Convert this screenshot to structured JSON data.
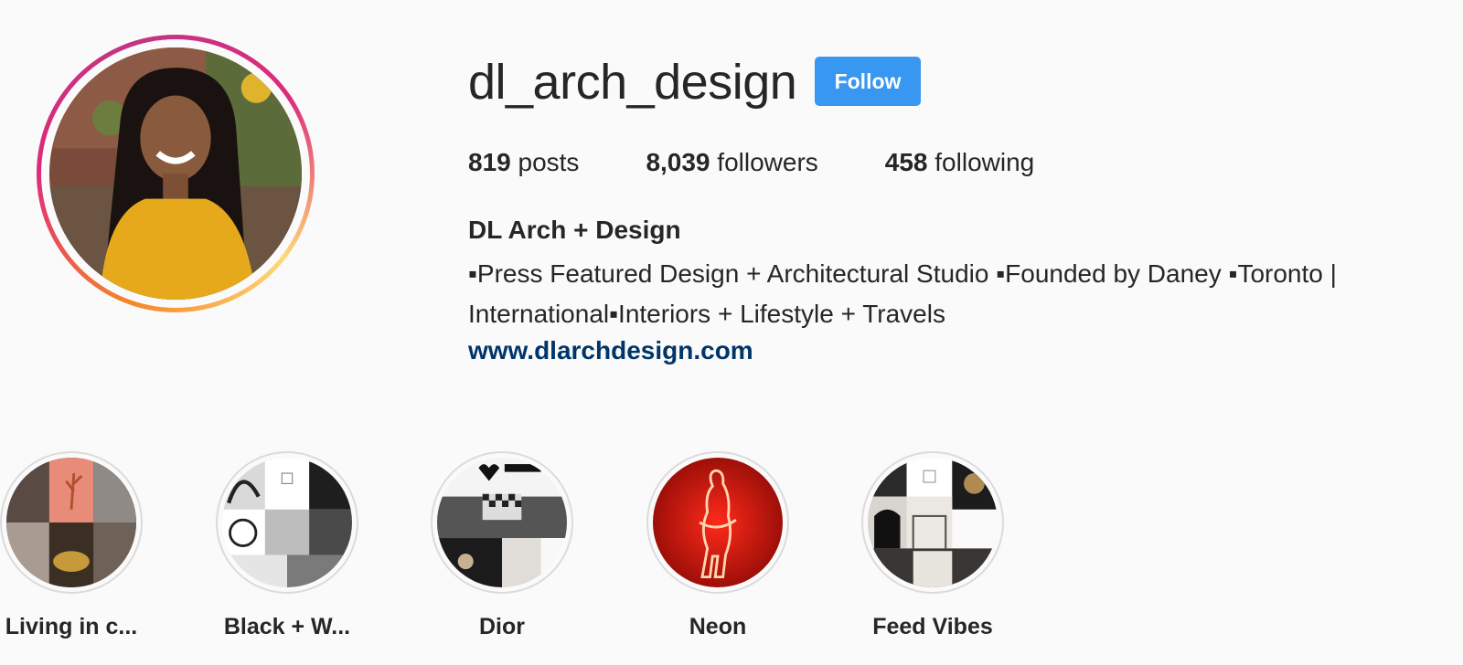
{
  "profile": {
    "username": "dl_arch_design",
    "follow_label": "Follow",
    "stats": {
      "posts_count": "819",
      "posts_label": "posts",
      "followers_count": "8,039",
      "followers_label": "followers",
      "following_count": "458",
      "following_label": "following"
    },
    "full_name": "DL Arch + Design",
    "bio": "▪Press Featured Design + Architectural Studio ▪Founded by Daney ▪Toronto | International▪Interiors + Lifestyle + Travels",
    "website": "www.dlarchdesign.com"
  },
  "highlights": [
    {
      "label": "Living in c..."
    },
    {
      "label": "Black + W..."
    },
    {
      "label": "Dior"
    },
    {
      "label": "Neon"
    },
    {
      "label": "Feed Vibes"
    }
  ],
  "colors": {
    "follow_button": "#3897f0",
    "link": "#003569",
    "story_ring_start": "#f58529",
    "story_ring_end": "#dd2a7b"
  }
}
